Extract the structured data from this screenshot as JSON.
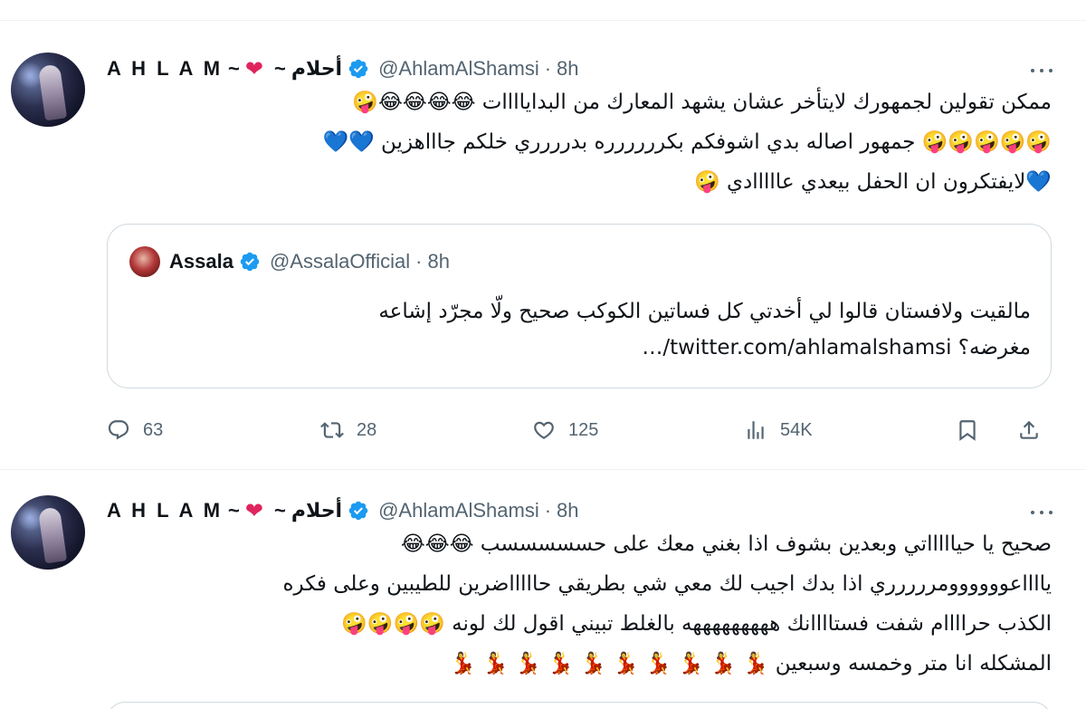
{
  "tweets": [
    {
      "author": {
        "name_latin": "A H L A M",
        "name_sep": "~",
        "name_sep2": "~",
        "name_arabic": "أحلام",
        "handle": "@AhlamAlShamsi",
        "time": "8h"
      },
      "body_lines": [
        "ممكن تقولين لجمهورك لايتأخر عشان يشهد المعارك من البداياااات",
        "جمهور اصاله بدي اشوفكم بكرررررره بدرررري خلكم جاااهزين",
        "لايفتكرون ان الحفل بيعدي عااااادي"
      ],
      "quote": {
        "name": "Assala",
        "handle": "@AssalaOfficial",
        "time": "8h",
        "text_lines": [
          "مالقيت ولافستان قالوا لي أخدتي كل فساتين الكوكب صحيح ولّا مجرّد إشاعه",
          "مغرضه؟ twitter.com/ahlamalshamsi/…"
        ]
      },
      "stats": {
        "replies": "63",
        "retweets": "28",
        "likes": "125",
        "views": "54K"
      }
    },
    {
      "author": {
        "name_latin": "A H L A M",
        "name_sep": "~",
        "name_sep2": "~",
        "name_arabic": "أحلام",
        "handle": "@AhlamAlShamsi",
        "time": "8h"
      },
      "body_lines": [
        "صحيح يا حياااااتي وبعدين بشوف اذا بغني معك على حسسسسسب",
        "يااااعوووووومررررري اذا بدك اجيب لك معي شي بطريقي حاااااضرين للطيبين وعلى فكره",
        "الكذب حراااام شفت فستاااانك هههههههههه بالغلط تبيني اقول لك لونه",
        "المشكله انا متر وخمسه وسبعين"
      ]
    }
  ],
  "colors": {
    "verified": "#1d9bf0",
    "heart": "#e0245e",
    "secondary_text": "#536471",
    "border": "#cfd9de"
  },
  "icons": [
    "verified-badge-icon",
    "heart-icon",
    "more-icon",
    "reply-icon",
    "retweet-icon",
    "like-icon",
    "views-icon",
    "bookmark-icon",
    "share-icon",
    "laughing-emoji",
    "zany-emoji",
    "blue-heart-emoji",
    "dancer-emoji"
  ]
}
